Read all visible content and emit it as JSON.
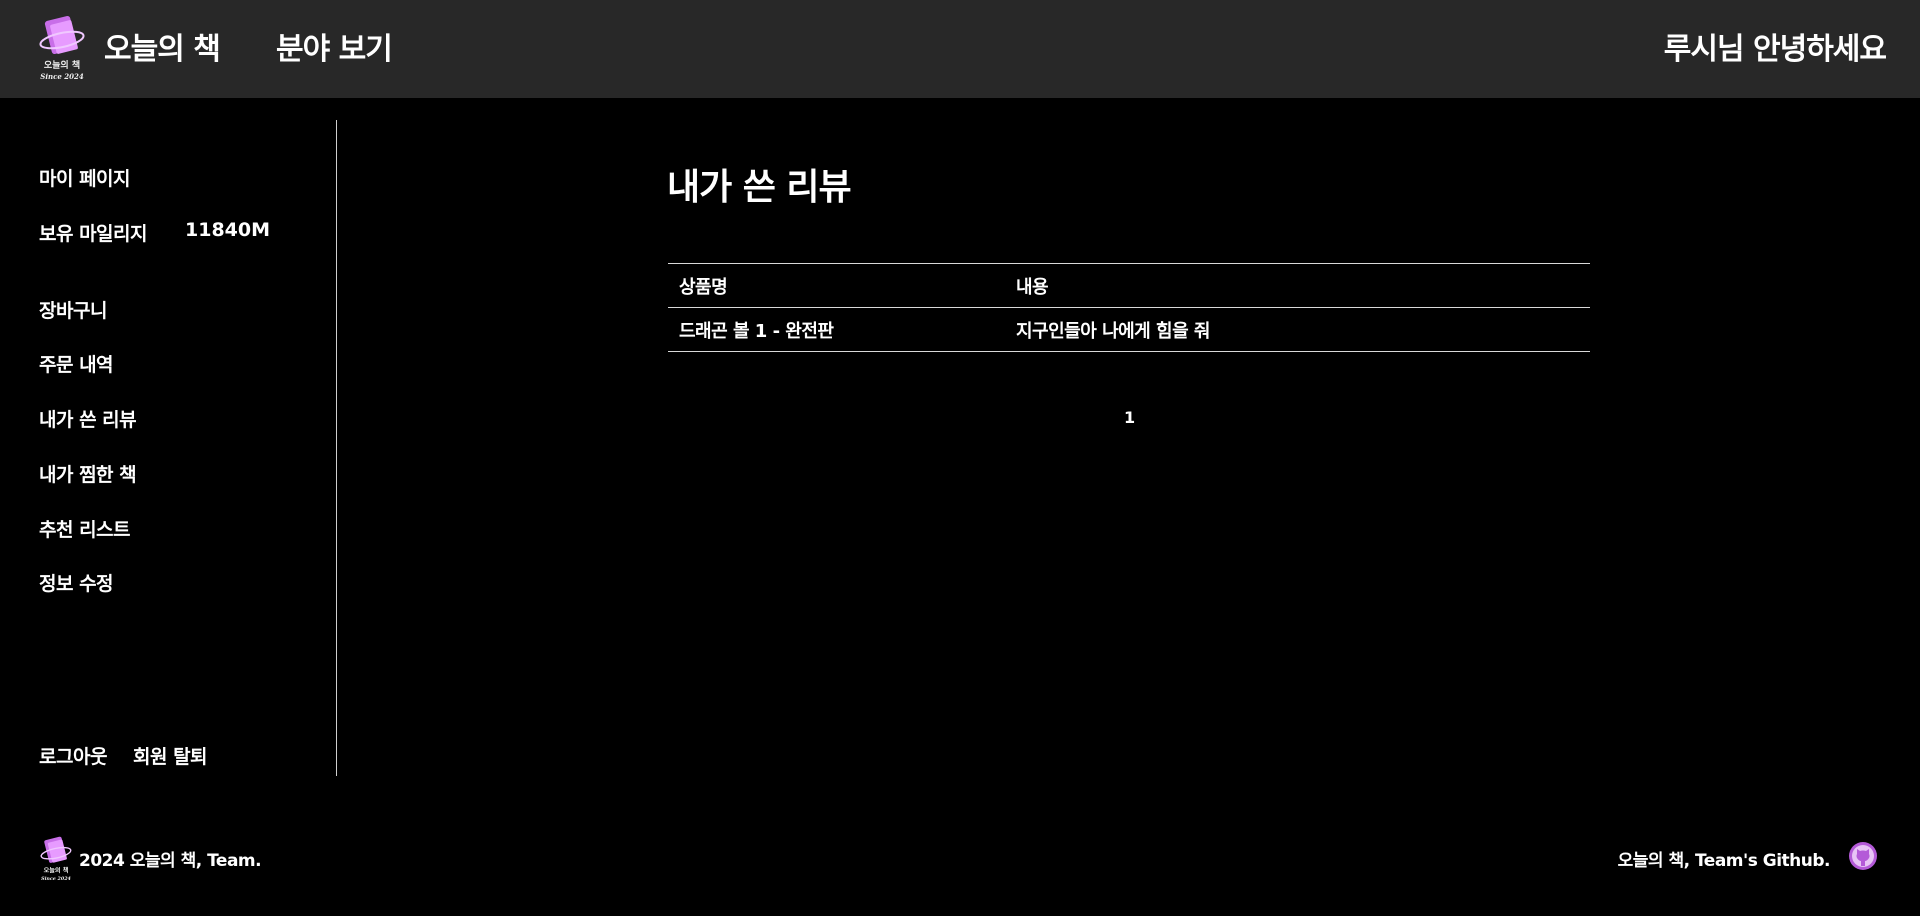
{
  "header": {
    "brand": "오늘의 책",
    "nav_genre": "분야 보기",
    "greeting": "루시님 안녕하세요",
    "logo_text_line1": "오늘의 책",
    "logo_text_line2": "Since 2024"
  },
  "sidebar": {
    "my_page": "마이 페이지",
    "mileage_label": "보유 마일리지",
    "mileage_value": "11840M",
    "items": [
      {
        "label": "장바구니"
      },
      {
        "label": "주문 내역"
      },
      {
        "label": "내가 쓴 리뷰"
      },
      {
        "label": "내가 찜한 책"
      },
      {
        "label": "추천 리스트"
      },
      {
        "label": "정보 수정"
      }
    ],
    "logout": "로그아웃",
    "withdraw": "회원 탈퇴"
  },
  "main": {
    "title": "내가 쓴 리뷰",
    "table": {
      "headers": [
        "상품명",
        "내용"
      ],
      "rows": [
        [
          "드래곤 볼 1 - 완전판",
          "지구인들아 나에게 힘을 줘"
        ]
      ]
    },
    "pagination": {
      "current": "1"
    }
  },
  "footer": {
    "copyright": "2024 오늘의 책, Team.",
    "github_text": "오늘의 책, Team's Github."
  },
  "colors": {
    "header_bg": "#282828",
    "page_bg": "#000000",
    "logo_accent": "#c86ee8",
    "github_icon": "#b45ad8"
  }
}
